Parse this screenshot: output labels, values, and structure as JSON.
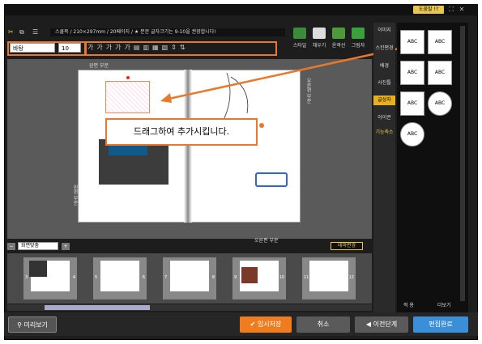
{
  "help_label": "도움말 !?",
  "info_text": "스쿨북 / 210×297mm / 20페이지 / ★ 분문 글자크기는 9-10을 권장합니다!",
  "font_select": "바탕",
  "size_select": "10",
  "style_buttons": [
    "가",
    "가",
    "가",
    "가",
    "가"
  ],
  "big_tools": [
    {
      "label": "스타일",
      "color": "#3a8c3a"
    },
    {
      "label": "채우기",
      "color": "#dddddd"
    },
    {
      "label": "윤곽선",
      "color": "#4c9a3a"
    },
    {
      "label": "그림자",
      "color": "#3aa03a"
    }
  ],
  "top_left_label": "왼편 부분",
  "top_right_label": "오른편 부분",
  "left_side_label": "왼편 부분",
  "right_side_label": "오른편 부분",
  "bottom_right_label": "오른편 부분",
  "tooltip": "드래그하여 추가시킵니다.",
  "view_select": "화면맞춤",
  "theme_button": "테마변경",
  "thumbs": [
    "3",
    "4",
    "5",
    "6",
    "7",
    "8",
    "9",
    "10",
    "11",
    "12"
  ],
  "side_tabs": [
    "이미지",
    "스킨편경",
    "배경",
    "사진틀",
    "글상자",
    "아이콘",
    "기능축소"
  ],
  "bubbles": [
    "ABC",
    "ABC",
    "ABC",
    "ABC",
    "ABC",
    "ABC",
    "ABC"
  ],
  "panel_apply": "적 용",
  "panel_more": "더보기",
  "preview_button": "미리보기",
  "save_button": "임시저장",
  "cancel_button": "취소",
  "prev_button": "이전단계",
  "done_button": "편집완료",
  "colors": {
    "accent": "#e8782c",
    "done": "#3a8fd8",
    "save": "#f07c20"
  }
}
